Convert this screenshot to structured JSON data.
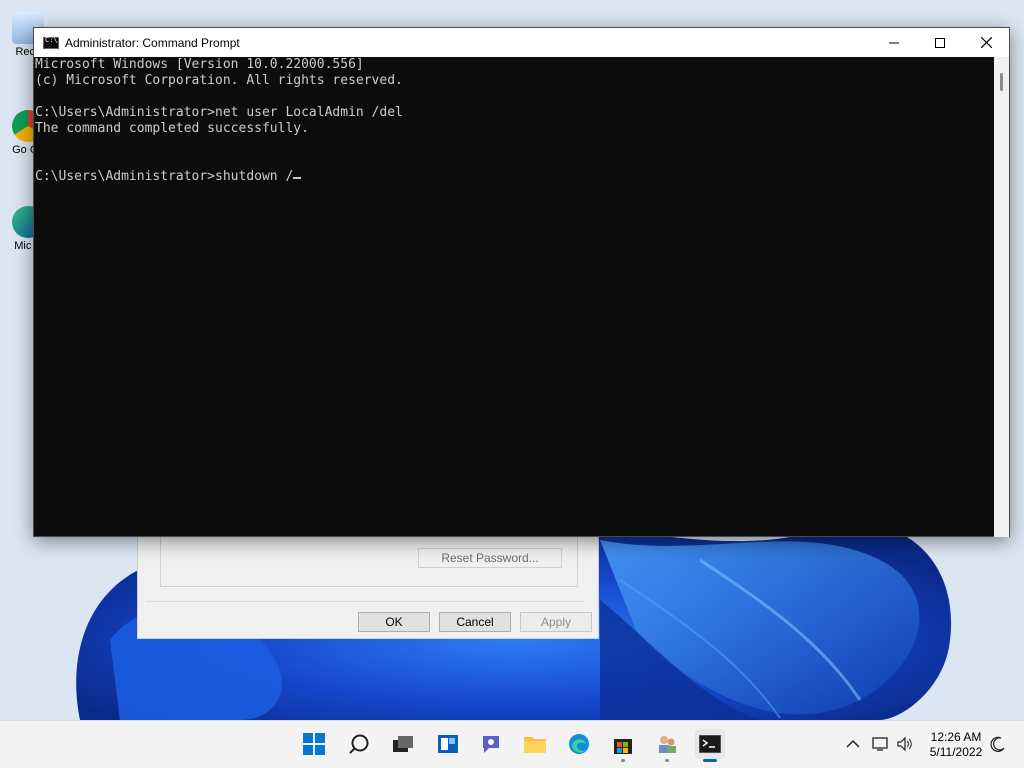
{
  "desktop": {
    "icons": [
      {
        "label": "Recy"
      },
      {
        "label": "Go Ch"
      },
      {
        "label": "Mic E"
      }
    ]
  },
  "dialog": {
    "reset_password_label": "Reset Password...",
    "ok_label": "OK",
    "cancel_label": "Cancel",
    "apply_label": "Apply"
  },
  "cmd": {
    "title": "Administrator: Command Prompt",
    "lines": [
      "Microsoft Windows [Version 10.0.22000.556]",
      "(c) Microsoft Corporation. All rights reserved.",
      "",
      "C:\\Users\\Administrator>net user LocalAdmin /del",
      "The command completed successfully.",
      "",
      "",
      "C:\\Users\\Administrator>shutdown /"
    ]
  },
  "taskbar": {
    "items": [
      "start-icon",
      "search-icon",
      "task-view-icon",
      "widgets-icon",
      "chat-icon",
      "file-explorer-icon",
      "edge-icon",
      "store-icon",
      "users-icon",
      "command-prompt-icon"
    ],
    "clock_time": "12:26 AM",
    "clock_date": "5/11/2022"
  },
  "colors": {
    "console_bg": "#0c0c0c",
    "console_text": "#cccccc",
    "accent": "#0067c0"
  }
}
